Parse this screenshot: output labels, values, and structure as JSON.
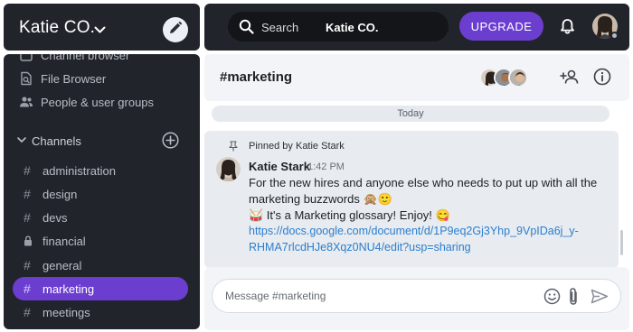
{
  "workspace": {
    "name": "Katie CO."
  },
  "topbar": {
    "search_label": "Search",
    "search_scope": "Katie CO.",
    "upgrade_label": "UPGRADE"
  },
  "sidebar": {
    "nav": [
      {
        "label": "Channel browser",
        "icon": "channel-browser-icon"
      },
      {
        "label": "File Browser",
        "icon": "file-search-icon"
      },
      {
        "label": "People & user groups",
        "icon": "people-icon"
      }
    ],
    "channels_header": "Channels",
    "channels": [
      {
        "name": "administration",
        "icon": "hash-icon"
      },
      {
        "name": "design",
        "icon": "hash-icon"
      },
      {
        "name": "devs",
        "icon": "hash-icon"
      },
      {
        "name": "financial",
        "icon": "lock-icon"
      },
      {
        "name": "general",
        "icon": "hash-icon"
      },
      {
        "name": "marketing",
        "icon": "hash-icon",
        "active": true
      },
      {
        "name": "meetings",
        "icon": "hash-icon"
      }
    ]
  },
  "channel": {
    "title": "#marketing"
  },
  "messages": {
    "date_divider": "Today",
    "pinned_by": "Pinned by Katie Stark",
    "author": "Katie Stark",
    "time": "1:42 PM",
    "line1": "For the new hires and anyone else who needs to put up with all the",
    "line2": "marketing buzzwords 🙊🙂",
    "line3": "🥁 It's a Marketing glossary! Enjoy! 😋",
    "link_line1": "https://docs.google.com/document/d/1P9eq2Gj3Yhp_9VpIDa6j_y-",
    "link_line2": "RHMA7rlcdHJe8Xqz0NU4/edit?usp=sharing"
  },
  "composer": {
    "placeholder": "Message #marketing"
  },
  "colors": {
    "accent": "#6c3ecf",
    "panel_dark": "#21252b",
    "link": "#2a7fd0"
  }
}
